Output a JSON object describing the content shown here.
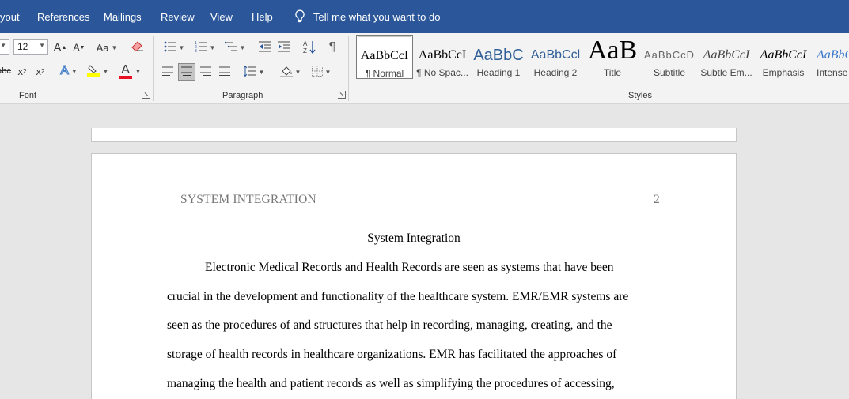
{
  "tabs": {
    "layout": "yout",
    "references": "References",
    "mailings": "Mailings",
    "review": "Review",
    "view": "View",
    "help": "Help",
    "tell_me": "Tell me what you want to do"
  },
  "font_group": {
    "label": "Font",
    "size_value": "12",
    "grow_icon": "A",
    "shrink_icon": "A",
    "change_case": "Aa",
    "strikethrough": "abc",
    "subscript": "x",
    "superscript": "x",
    "text_effects": "A",
    "font_color_icon": "A",
    "font_color": "#e81123",
    "highlight_color": "#ffff00"
  },
  "paragraph_group": {
    "label": "Paragraph",
    "pilcrow": "¶"
  },
  "styles_group": {
    "label": "Styles",
    "items": [
      {
        "preview": "AaBbCcI",
        "name": "¶ Normal"
      },
      {
        "preview": "AaBbCcI",
        "name": "¶ No Spac..."
      },
      {
        "preview": "AaBbC",
        "name": "Heading 1"
      },
      {
        "preview": "AaBbCcl",
        "name": "Heading 2"
      },
      {
        "preview": "AaB",
        "name": "Title"
      },
      {
        "preview": "AaBbCcD",
        "name": "Subtitle"
      },
      {
        "preview": "AaBbCcI",
        "name": "Subtle Em..."
      },
      {
        "preview": "AaBbCcI",
        "name": "Emphasis"
      },
      {
        "preview": "AaBbC",
        "name": "Intense"
      }
    ]
  },
  "document": {
    "running_head": "SYSTEM INTEGRATION",
    "page_number": "2",
    "title": "System Integration",
    "lines": [
      "Electronic Medical Records and Health Records are seen as systems that have been",
      "crucial in the development and functionality of the healthcare system. EMR/EMR systems are",
      "seen as the procedures of and structures that help in recording, managing, creating, and the",
      "storage of health records in healthcare organizations. EMR has facilitated the approaches of",
      "managing the health and patient records as well as simplifying the procedures of accessing,"
    ]
  },
  "colors": {
    "title_bar": "#2b579a",
    "ribbon": "#f3f3f3",
    "canvas": "#e6e6e6",
    "heading_blue": "#2e5e97"
  }
}
